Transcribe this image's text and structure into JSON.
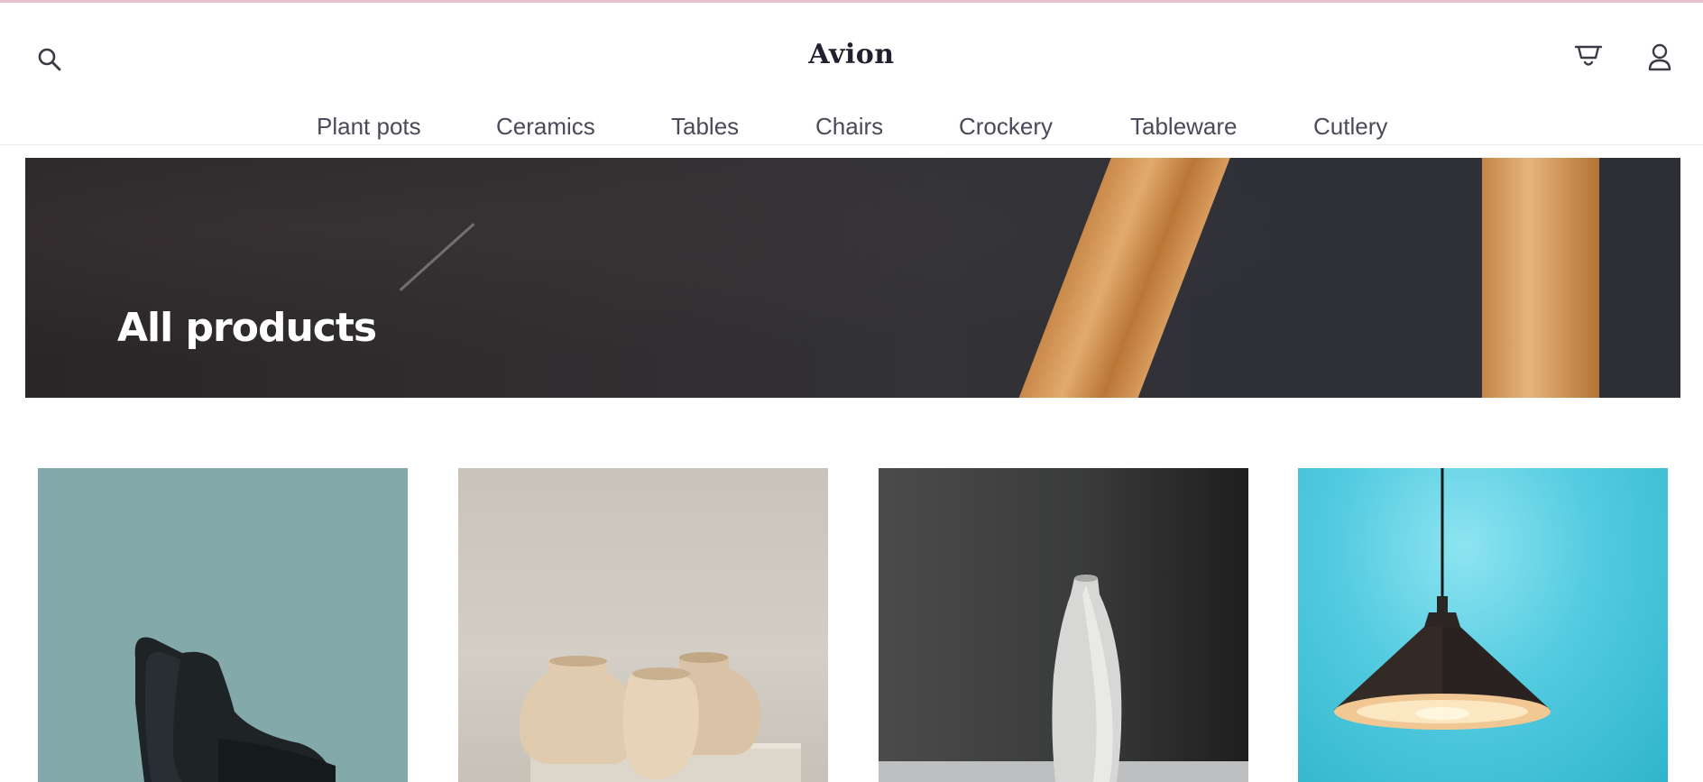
{
  "header": {
    "logo": "Avion",
    "icons": {
      "search": "search-icon",
      "cart": "cart-icon",
      "user": "user-icon"
    }
  },
  "nav": {
    "items": [
      {
        "label": "Plant pots"
      },
      {
        "label": "Ceramics"
      },
      {
        "label": "Tables"
      },
      {
        "label": "Chairs"
      },
      {
        "label": "Crockery"
      },
      {
        "label": "Tableware"
      },
      {
        "label": "Cutlery"
      }
    ]
  },
  "hero": {
    "title": "All products"
  },
  "products": [
    {
      "image": "black-chair-image"
    },
    {
      "image": "clay-vases-image"
    },
    {
      "image": "white-bottle-vase-image"
    },
    {
      "image": "pendant-lamp-image"
    }
  ],
  "colors": {
    "accent_line": "#e8c3d0",
    "text_dark": "#2a254b",
    "hero_bg": "#2f2d31"
  }
}
